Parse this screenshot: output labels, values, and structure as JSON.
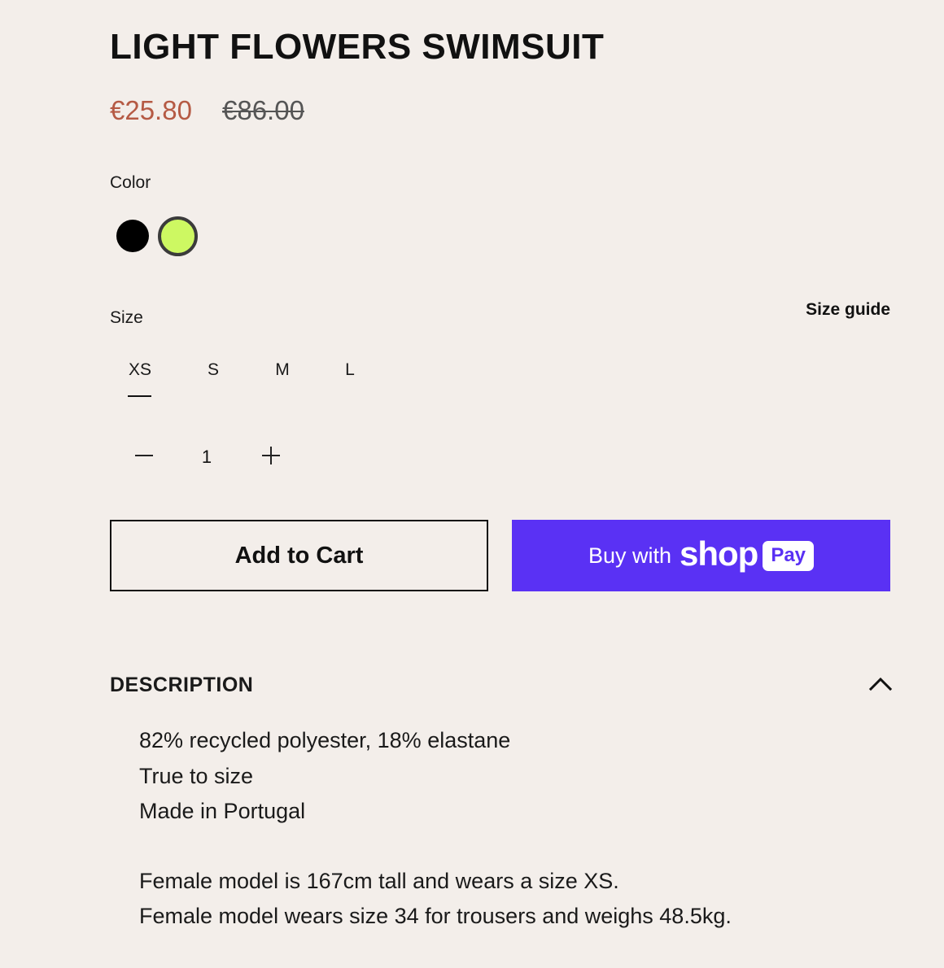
{
  "product": {
    "title": "LIGHT FLOWERS SWIMSUIT",
    "sale_price": "€25.80",
    "original_price": "€86.00"
  },
  "color": {
    "label": "Color",
    "options": [
      {
        "name": "black",
        "hex": "#000000",
        "selected": false
      },
      {
        "name": "lime",
        "hex": "#cdf862",
        "selected": true
      }
    ]
  },
  "size": {
    "label": "Size",
    "guide_label": "Size guide",
    "options": [
      "XS",
      "S",
      "M",
      "L"
    ],
    "selected": "XS"
  },
  "quantity": {
    "value": "1",
    "decrement_icon": "minus-icon",
    "increment_icon": "plus-icon"
  },
  "buttons": {
    "add_to_cart": "Add to Cart",
    "shop_pay_prefix": "Buy with",
    "shop_pay_brand": "shop",
    "shop_pay_badge": "Pay",
    "shop_pay_color": "#5a31f4"
  },
  "description": {
    "heading": "DESCRIPTION",
    "toggle_icon": "chevron-up-icon",
    "expanded": true,
    "lines": [
      "82% recycled polyester, 18% elastane",
      "True to size",
      "Made in Portugal",
      "Female model is 167cm tall and wears a size XS.",
      "Female model wears size 34 for trousers and weighs 48.5kg."
    ]
  },
  "colors": {
    "background": "#f3eeea",
    "sale_price": "#b55a44"
  }
}
